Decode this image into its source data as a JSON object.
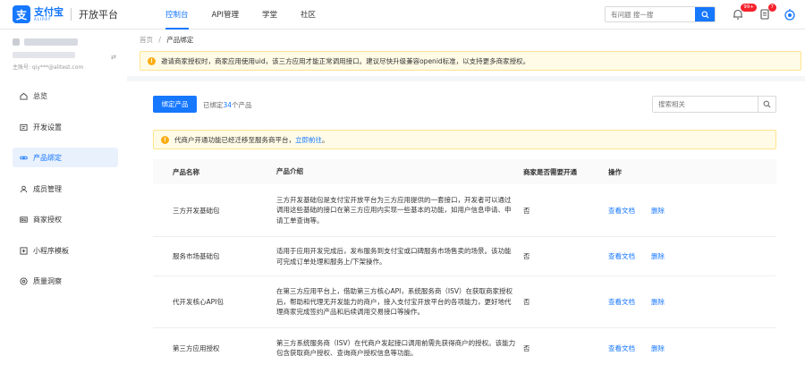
{
  "header": {
    "logo_cn": "支付宝",
    "logo_en": "ALIPAY",
    "platform": "开放平台",
    "nav": [
      "控制台",
      "API管理",
      "学堂",
      "社区"
    ],
    "search_placeholder": "有问题 搜一搜",
    "notification_badge": "99+",
    "message_badge": "7"
  },
  "sidebar": {
    "account_line": "主账号: qiy***@alitest.com",
    "items": [
      "总览",
      "开发设置",
      "产品绑定",
      "成员管理",
      "商家授权",
      "小程序模板",
      "质量洞察"
    ],
    "active": "产品绑定"
  },
  "main": {
    "breadcrumb_home": "首页",
    "breadcrumb_sep": "/",
    "breadcrumb_current": "产品绑定",
    "top_notice": "邀请商家授权时，商家应用使用uid，该三方应用才能正常调用接口。建议尽快升级兼容openid标准，以支持更多商家授权。",
    "bind_button": "绑定产品",
    "bound_prefix": "已绑定",
    "bound_count": "34",
    "bound_suffix": "个产品",
    "search_placeholder": "搜索相关",
    "inner_notice": "代商户开通功能已经迁移至服务商平台，",
    "inner_notice_link": "立即前往",
    "inner_notice_end": "。",
    "table": {
      "headers": [
        "产品名称",
        "产品介绍",
        "商家是否需要开通",
        "操作"
      ],
      "rows": [
        {
          "name": "三方开发基础包",
          "desc": "三方开发基础包是支付宝开放平台为三方应用提供的一套接口，开发者可以通过调用这些基础的接口在第三方应用内实现一些基本的功能，如用户信息申请、申请工单查询等。",
          "need": "否",
          "action1": "查看文档",
          "action2": "删除"
        },
        {
          "name": "服务市场基础包",
          "desc": "适用于应用开发完成后，发布服务到支付宝或口碑服务市场售卖的场景。该功能可完成订单处理和服务上/下架操作。",
          "need": "否",
          "action1": "查看文档",
          "action2": "删除"
        },
        {
          "name": "代开发核心API包",
          "desc": "在第三方应用平台上，借助第三方核心API，系统服务商（ISV）在获取商家授权后，帮助和代理无开发能力的商户，接入支付宝开放平台的各项能力，更好地代理商家完成签约产品和后续调用交易接口等操作。",
          "need": "否",
          "action1": "查看文档",
          "action2": "删除"
        },
        {
          "name": "第三方应用授权",
          "desc": "第三方系统服务商（ISV）在代商户发起接口调用前需先获得商户的授权。该能力包含获取商户授权、查询商户授权信息等功能。",
          "need": "否",
          "action1": "查看文档",
          "action2": "删除"
        }
      ]
    }
  },
  "colors": {
    "primary": "#1677ff",
    "warning": "#faad14",
    "notice_bg": "#fffbe6"
  }
}
